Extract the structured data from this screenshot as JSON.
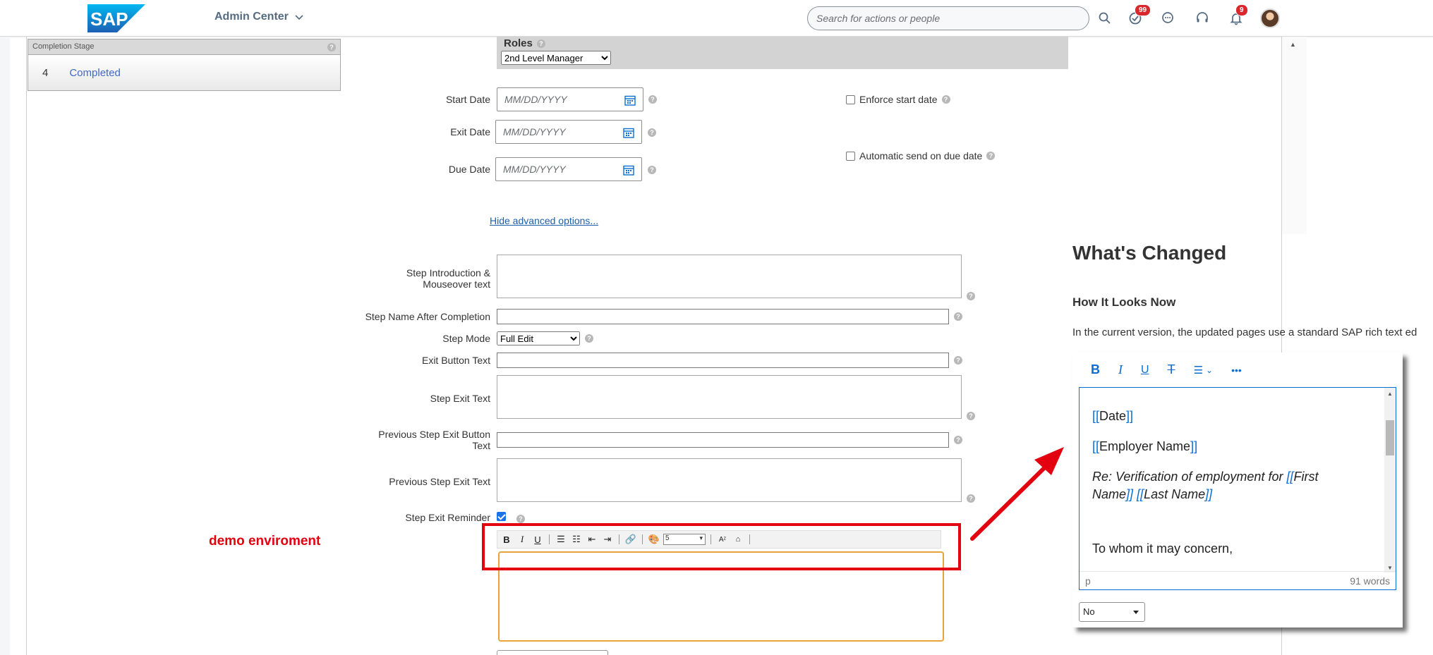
{
  "header": {
    "app_title": "Admin Center",
    "search_placeholder": "Search for actions or people",
    "todo_badge": "99",
    "notif_badge": "9"
  },
  "stage_panel": {
    "title": "Completion Stage",
    "number": "4",
    "label": "Completed"
  },
  "roles": {
    "title": "Roles",
    "selected": "2nd Level Manager"
  },
  "dates": {
    "start_label": "Start Date",
    "exit_label": "Exit Date",
    "due_label": "Due Date",
    "placeholder": "MM/DD/YYYY"
  },
  "options": {
    "enforce_start": "Enforce start date",
    "auto_send": "Automatic send on due date",
    "hide_advanced": "Hide advanced options..."
  },
  "form": {
    "step_intro": "Step Introduction &",
    "step_intro_2": "Mouseover text",
    "step_name_after": "Step Name After Completion",
    "step_mode": "Step Mode",
    "step_mode_value": "Full Edit",
    "exit_button_text": "Exit Button Text",
    "step_exit_text": "Step Exit Text",
    "prev_step_exit_button": "Previous Step Exit Button",
    "prev_step_exit_button_2": "Text",
    "prev_step_exit_text": "Previous Step Exit Text",
    "step_exit_reminder": "Step Exit Reminder",
    "font_size_value": "5"
  },
  "demo_label": "demo enviroment",
  "whats_changed": {
    "title": "What's Changed",
    "subtitle": "How It Looks Now",
    "text": "In the current version, the updated pages use a standard SAP rich text ed",
    "editor": {
      "line_date": "Date",
      "line_employer": "Employer Name",
      "re_prefix": "Re: Verification of employment for ",
      "first_name": "First",
      "first_name_2": "Name",
      "last_name": "Last Name",
      "greeting": "To whom it may concern,",
      "status_tag": "p",
      "word_count": "91 words"
    },
    "select_value": "No"
  },
  "colors": {
    "sap_blue": "#0a6ed1",
    "highlight_red": "#e3000f",
    "focus_orange": "#e8a33d"
  }
}
